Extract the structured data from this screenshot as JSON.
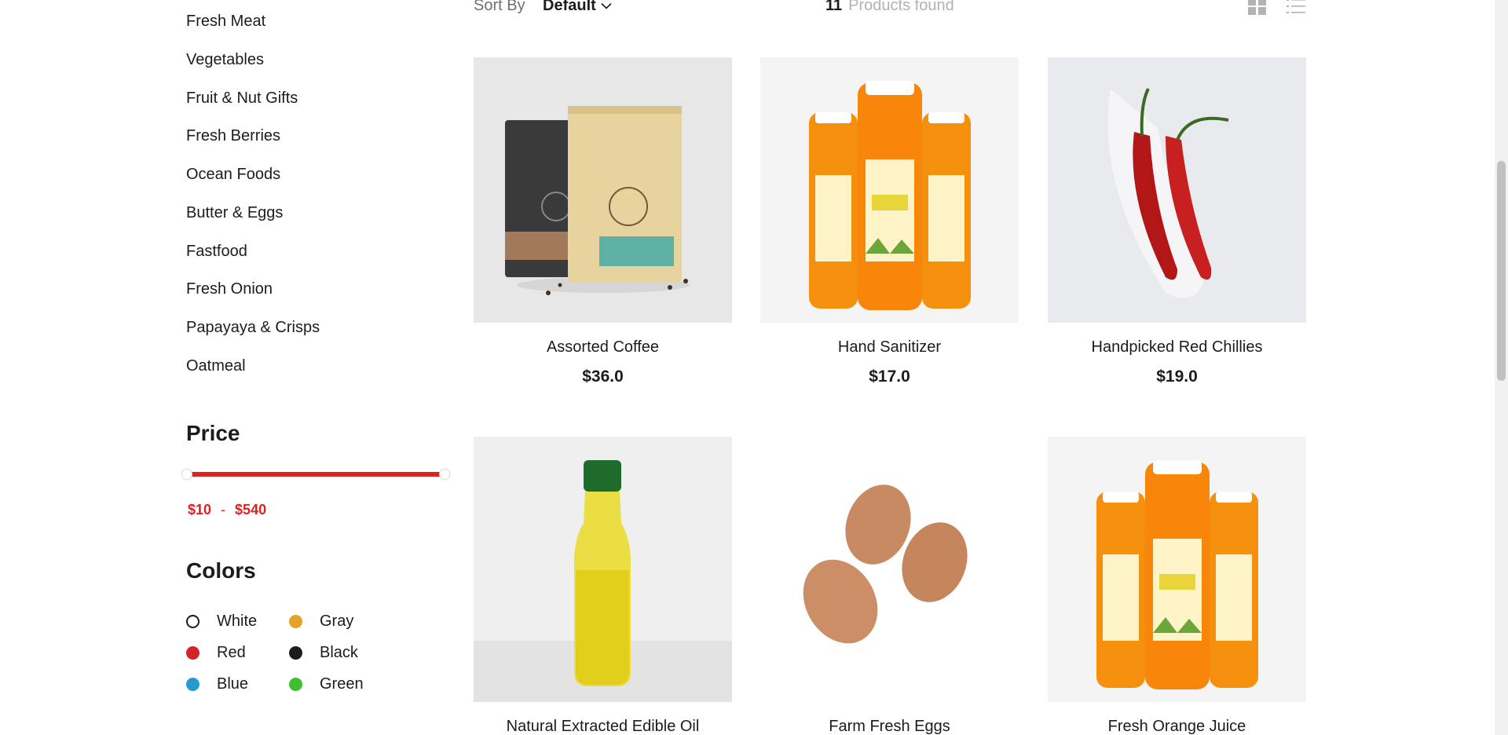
{
  "categories": [
    {
      "label": "Fresh Meat"
    },
    {
      "label": "Vegetables"
    },
    {
      "label": "Fruit & Nut Gifts"
    },
    {
      "label": "Fresh Berries"
    },
    {
      "label": "Ocean Foods"
    },
    {
      "label": "Butter & Eggs"
    },
    {
      "label": "Fastfood"
    },
    {
      "label": "Fresh Onion"
    },
    {
      "label": "Papayaya & Crisps"
    },
    {
      "label": "Oatmeal"
    }
  ],
  "price": {
    "title": "Price",
    "min_label": "$10",
    "separator": "-",
    "max_label": "$540",
    "accent_color": "#dd2222"
  },
  "colors": {
    "title": "Colors",
    "items": [
      {
        "label": "White",
        "hex": "#ffffff"
      },
      {
        "label": "Gray",
        "hex": "#e4a42b"
      },
      {
        "label": "Red",
        "hex": "#d42424"
      },
      {
        "label": "Black",
        "hex": "#1c1c1c"
      },
      {
        "label": "Blue",
        "hex": "#249bd3"
      },
      {
        "label": "Green",
        "hex": "#3cc032"
      }
    ]
  },
  "toolbar": {
    "sort_label": "Sort By",
    "sort_value": "Default",
    "found_count": "11",
    "found_label": "Products found",
    "grid_icon": "grid-view-icon",
    "list_icon": "list-view-icon"
  },
  "products": [
    {
      "name": "Assorted Coffee",
      "price": "$36.0",
      "image": "coffee-bags"
    },
    {
      "name": "Hand Sanitizer",
      "price": "$17.0",
      "image": "orange-bottles"
    },
    {
      "name": "Handpicked Red Chillies",
      "price": "$19.0",
      "image": "red-chillies"
    },
    {
      "name": "Natural Extracted Edible Oil",
      "price": "",
      "image": "oil-bottle"
    },
    {
      "name": "Farm Fresh Eggs",
      "price": "",
      "image": "eggs"
    },
    {
      "name": "Fresh Orange Juice",
      "price": "",
      "image": "orange-bottles"
    }
  ]
}
